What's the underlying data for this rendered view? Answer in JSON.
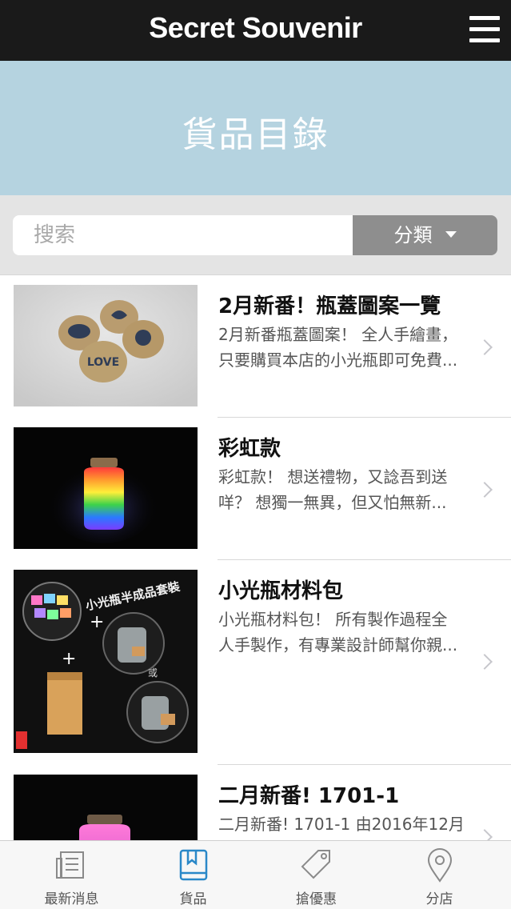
{
  "app": {
    "title": "Secret Souvenir"
  },
  "banner": {
    "title": "貨品目錄"
  },
  "search": {
    "placeholder": "搜索",
    "category_label": "分類"
  },
  "items": [
    {
      "title": "2月新番！瓶蓋圖案一覽",
      "desc_line1": "2月新番瓶蓋圖案！ 全人手繪畫，",
      "desc_line2": "只要購買本店的小光瓶即可免費...",
      "thumb_text": "LOVE"
    },
    {
      "title": "彩虹款",
      "desc_line1": "彩虹款！ 想送禮物，又諗吾到送",
      "desc_line2": "咩？ 想獨一無異，但又怕無新..."
    },
    {
      "title": "小光瓶材料包",
      "desc_line1": "小光瓶材料包！ 所有製作過程全",
      "desc_line2": "人手製作，有專業設計師幫你親...",
      "thumb_text": "小光瓶半成品套裝",
      "thumb_or": "或"
    },
    {
      "title": "二月新番! 1701-1",
      "desc_line1": "二月新番! 1701-1 由2016年12月",
      "desc_line2": ""
    }
  ],
  "tabs": [
    {
      "label": "最新消息",
      "icon": "newspaper-icon"
    },
    {
      "label": "貨品",
      "icon": "book-icon",
      "active": true
    },
    {
      "label": "搶優惠",
      "icon": "tag-icon"
    },
    {
      "label": "分店",
      "icon": "location-pin-icon"
    }
  ],
  "colors": {
    "topbar": "#1a1a1a",
    "banner": "#b5d3e0",
    "active_tab": "#2a88c8",
    "inactive_tab": "#8a8a8a"
  }
}
